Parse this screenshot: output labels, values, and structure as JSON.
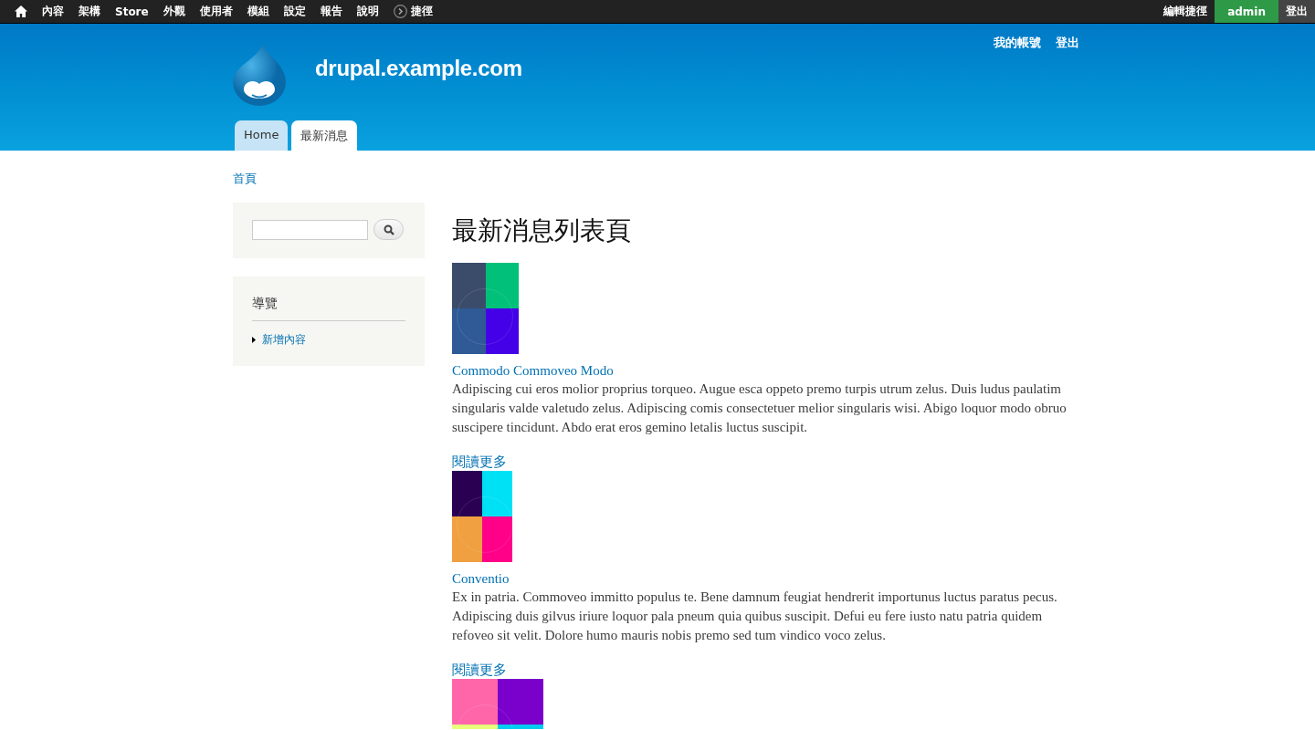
{
  "toolbar": {
    "menu": [
      "內容",
      "架構",
      "Store",
      "外觀",
      "使用者",
      "模組",
      "設定",
      "報告",
      "說明"
    ],
    "shortcuts": "捷徑",
    "edit_shortcuts": "編輯捷徑",
    "user": "admin",
    "logout": "登出"
  },
  "header": {
    "site_name": "drupal.example.com",
    "secondary_menu": [
      "我的帳號",
      "登出"
    ],
    "tabs": [
      {
        "label": "Home",
        "selected": false
      },
      {
        "label": "最新消息",
        "selected": true
      }
    ]
  },
  "breadcrumb": "首頁",
  "sidebar": {
    "navigation": {
      "title": "導覽",
      "items": [
        "新增內容"
      ]
    }
  },
  "page_title": "最新消息列表頁",
  "articles": [
    {
      "image": true,
      "title": "Commodo Commoveo Modo",
      "body": "Adipiscing cui eros molior proprius torqueo. Augue esca oppeto premo turpis utrum zelus. Duis ludus paulatim singularis valde valetudo zelus. Adipiscing comis consectetuer melior singularis wisi. Abigo loquor modo obruo suscipere tincidunt. Abdo erat eros gemino letalis luctus suscipit.",
      "read_more": "閱讀更多"
    },
    {
      "image": true,
      "title": "Conventio",
      "body": "Ex in patria. Commoveo immitto populus te. Bene damnum feugiat hendrerit importunus luctus paratus pecus. Adipiscing duis gilvus iriure loquor pala pneum quia quibus suscipit. Defui eu fere iusto natu patria quidem refoveo sit velit. Dolore humo mauris nobis premo sed tum vindico voco zelus.",
      "read_more": "閱讀更多"
    },
    {
      "image": true
    }
  ]
}
